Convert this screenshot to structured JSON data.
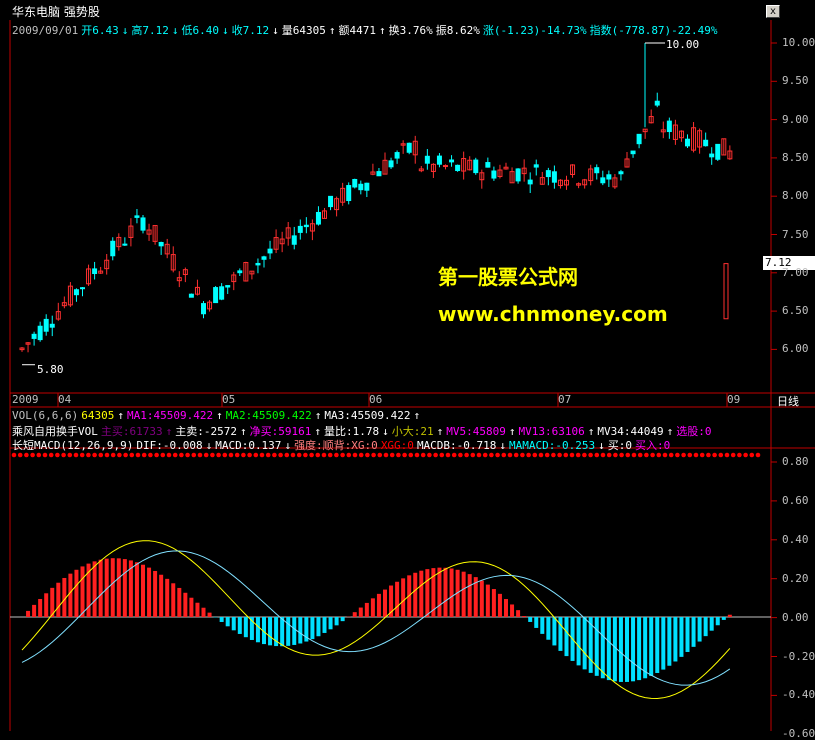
{
  "window": {
    "title": "华东电脑 强势股",
    "close": "x"
  },
  "quote": [
    {
      "t": "2009/09/01",
      "c": "#c0c0c0"
    },
    {
      "t": "开6.43",
      "c": "#00ffff"
    },
    {
      "t": "↓",
      "c": "#00ffff"
    },
    {
      "t": "高7.12",
      "c": "#00ffff"
    },
    {
      "t": "↓",
      "c": "#00ffff"
    },
    {
      "t": "低6.40",
      "c": "#00ffff"
    },
    {
      "t": "↓",
      "c": "#00ffff"
    },
    {
      "t": "收7.12",
      "c": "#00ffff"
    },
    {
      "t": "↓",
      "c": "#ffffff"
    },
    {
      "t": "量64305",
      "c": "#ffffff"
    },
    {
      "t": "↑",
      "c": "#ffffff"
    },
    {
      "t": "额4471",
      "c": "#ffffff"
    },
    {
      "t": "↑",
      "c": "#ffffff"
    },
    {
      "t": "换3.76%",
      "c": "#ffffff"
    },
    {
      "t": "振8.62%",
      "c": "#ffffff"
    },
    {
      "t": "涨(-1.23)-14.73%",
      "c": "#00ffff"
    },
    {
      "t": "指数(-778.87)-22.49%",
      "c": "#00ffff"
    }
  ],
  "price_axis": [
    "10.00",
    "9.50",
    "9.00",
    "8.50",
    "8.00",
    "7.50",
    "7.00",
    "6.50",
    "6.00"
  ],
  "price_tag": "7.12",
  "low_mark": "5.80",
  "high_mark": "10.00",
  "date_axis": [
    "2009",
    "04",
    "05",
    "06",
    "07",
    "09"
  ],
  "period_button": "日线",
  "watermark": {
    "line1": "第一股票公式网",
    "line2": "www.chnmoney.com"
  },
  "vol_row": [
    {
      "t": "VOL(6,6,6)",
      "c": "#c0c0c0"
    },
    {
      "t": "64305",
      "c": "#ffff00"
    },
    {
      "t": "↑",
      "c": "#ffffff"
    },
    {
      "t": "MA1:45509.422",
      "c": "#ff00ff"
    },
    {
      "t": "↑",
      "c": "#ffffff"
    },
    {
      "t": "MA2:45509.422",
      "c": "#00ff00"
    },
    {
      "t": "↑",
      "c": "#ffffff"
    },
    {
      "t": "MA3:45509.422",
      "c": "#ffffff"
    },
    {
      "t": "↑",
      "c": "#ffffff"
    }
  ],
  "wind_row": [
    {
      "t": "乘风自用换手VOL",
      "c": "#ffffff"
    },
    {
      "t": "主买:61733",
      "c": "#800080"
    },
    {
      "t": "↑",
      "c": "#800080"
    },
    {
      "t": "主卖:-2572",
      "c": "#ffffff"
    },
    {
      "t": "↑",
      "c": "#ffffff"
    },
    {
      "t": "净买:59161",
      "c": "#ff00ff"
    },
    {
      "t": "↑",
      "c": "#ffffff"
    },
    {
      "t": "量比:1.78",
      "c": "#ffffff"
    },
    {
      "t": "↓",
      "c": "#ffffff"
    },
    {
      "t": "小大:21",
      "c": "#c0c000"
    },
    {
      "t": "↑",
      "c": "#ffffff"
    },
    {
      "t": "MV5:45809",
      "c": "#ff00ff"
    },
    {
      "t": "↑",
      "c": "#ffffff"
    },
    {
      "t": "MV13:63106",
      "c": "#ff00ff"
    },
    {
      "t": "↑",
      "c": "#ffffff"
    },
    {
      "t": "MV34:44049",
      "c": "#ffffff"
    },
    {
      "t": "↑",
      "c": "#ffffff"
    },
    {
      "t": "选股:0",
      "c": "#ff00ff"
    }
  ],
  "macd_row": [
    {
      "t": "长短MACD(12,26,9,9)",
      "c": "#ffffff"
    },
    {
      "t": "DIF:-0.008",
      "c": "#ffffff"
    },
    {
      "t": "↓",
      "c": "#ffffff"
    },
    {
      "t": "MACD:0.137",
      "c": "#ffffff"
    },
    {
      "t": "↓",
      "c": "#ffffff"
    },
    {
      "t": "强度:顺背:XG:0",
      "c": "#ff8080"
    },
    {
      "t": "XGG:0",
      "c": "#ff0000"
    },
    {
      "t": "MACDB:-0.718",
      "c": "#ffffff"
    },
    {
      "t": "↓",
      "c": "#ffffff"
    },
    {
      "t": "MAMACD:-0.253",
      "c": "#00ffff"
    },
    {
      "t": "↓",
      "c": "#ffffff"
    },
    {
      "t": "买:0",
      "c": "#ffffff"
    },
    {
      "t": "买入:0",
      "c": "#ff00ff"
    }
  ],
  "macd_axis": [
    "0.80",
    "0.60",
    "0.40",
    "0.20",
    "0.00",
    "-0.20",
    "-0.40",
    "-0.60"
  ],
  "colors": {
    "up": "#ff3030",
    "down": "#00ffff",
    "grid": "#c00000",
    "dif": "#ffffff",
    "dea": "#ffff00"
  }
}
